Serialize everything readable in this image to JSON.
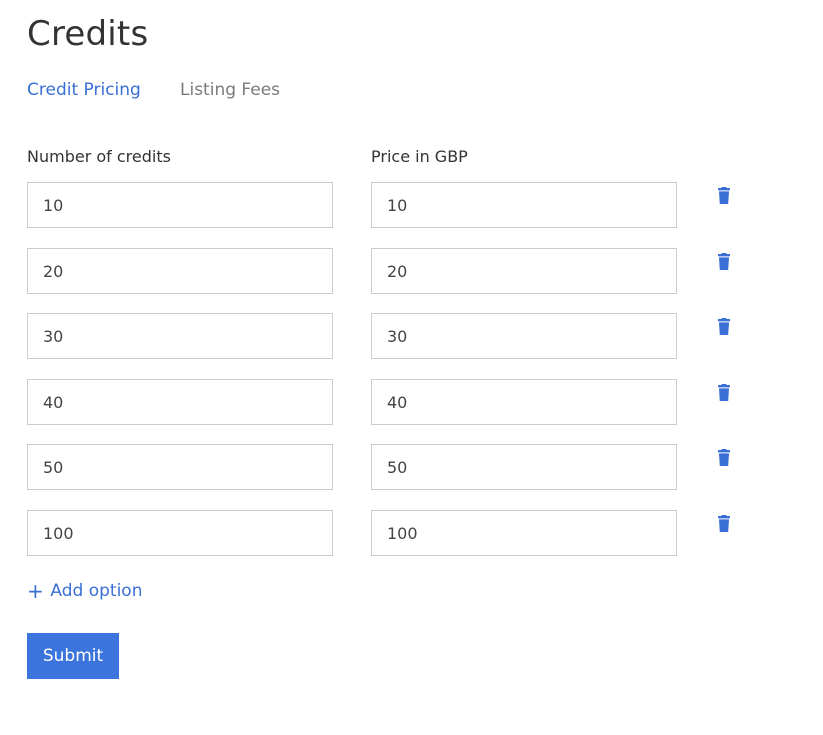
{
  "page": {
    "title": "Credits"
  },
  "tabs": [
    {
      "label": "Credit Pricing",
      "active": true
    },
    {
      "label": "Listing Fees",
      "active": false
    }
  ],
  "columns": {
    "credits_label": "Number of credits",
    "price_label": "Price in GBP"
  },
  "rows": [
    {
      "credits": "10",
      "price": "10"
    },
    {
      "credits": "20",
      "price": "20"
    },
    {
      "credits": "30",
      "price": "30"
    },
    {
      "credits": "40",
      "price": "40"
    },
    {
      "credits": "50",
      "price": "50"
    },
    {
      "credits": "100",
      "price": "100"
    }
  ],
  "actions": {
    "add_option_icon": "+",
    "add_option_label": "Add option",
    "submit_label": "Submit",
    "delete_icon": "trash-icon"
  },
  "colors": {
    "accent": "#3a6fd6",
    "button": "#3a74dc",
    "inactive_tab": "#7a7a7a",
    "border": "#cccccc"
  }
}
